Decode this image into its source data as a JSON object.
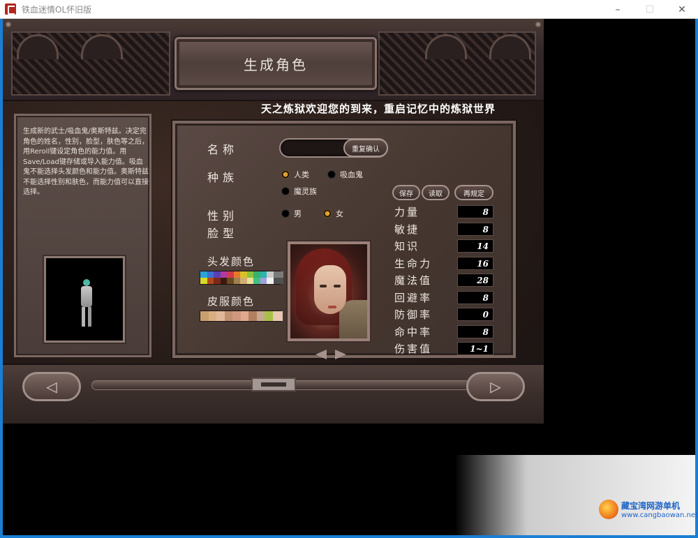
{
  "window": {
    "title": "铁血迷情OL怀旧版",
    "controls": [
      "–",
      "☐",
      "✕"
    ]
  },
  "screen": {
    "title": "生成角色",
    "welcome": "天之炼狱欢迎您的到来，重启记忆中的炼狱世界"
  },
  "help": {
    "text": "生成新的武士/吸血鬼/奥斯特兹。决定完角色的姓名，性别，脸型，肤色等之后，用Reroll键设定角色的能力值。用Save/Load键存储或导入能力值。吸血鬼不能选择头发颜色和能力值。奥斯特兹不能选择性别和肤色，而能力值可以直接选择。"
  },
  "form": {
    "name_label": "名称",
    "confirm_button": "重复确认",
    "race_label": "种族",
    "races": [
      {
        "label": "人类",
        "selected": true
      },
      {
        "label": "吸血鬼",
        "selected": false
      },
      {
        "label": "魔灵族",
        "selected": false
      }
    ],
    "gender_label": "性别",
    "genders": [
      {
        "label": "男",
        "selected": false
      },
      {
        "label": "女",
        "selected": true
      }
    ],
    "face_label": "脸型",
    "hair_color_label": "头发颜色",
    "skin_color_label": "皮服颜色"
  },
  "hair_colors": [
    "#2aa3d8",
    "#3b6fd0",
    "#5a3fb4",
    "#b23a9f",
    "#d23a4a",
    "#e27a2a",
    "#d9c12a",
    "#8bc43a",
    "#3bb06b",
    "#2ab5b0",
    "#c9c9c9",
    "#7a7a7a",
    "#d8d82a",
    "#b04a1a",
    "#7a2a1a",
    "#3a1a10",
    "#6a4a20",
    "#a08050",
    "#d0b070",
    "#eedd99",
    "#40c080",
    "#a0a0e0",
    "#f0f0f0",
    "#505050"
  ],
  "skin_colors": [
    "#c8a070",
    "#d8b080",
    "#e0b898",
    "#c09070",
    "#d09880",
    "#e0a890",
    "#b08060",
    "#c8a890",
    "#a8c048",
    "#e8c8b0"
  ],
  "actions": {
    "save": "保存",
    "load": "读取",
    "reroll": "再规定"
  },
  "stats": [
    {
      "label": "力量",
      "value": "8"
    },
    {
      "label": "敏捷",
      "value": "8"
    },
    {
      "label": "知识",
      "value": "14"
    },
    {
      "label": "生命力",
      "value": "16"
    },
    {
      "label": "魔法值",
      "value": "28"
    },
    {
      "label": "回避率",
      "value": "8"
    },
    {
      "label": "防御率",
      "value": "0"
    },
    {
      "label": "命中率",
      "value": "8"
    },
    {
      "label": "伤害值",
      "value": "1~1"
    }
  ],
  "watermark": {
    "name": "藏宝湾网游单机",
    "url": "www.cangbaowan.net"
  }
}
